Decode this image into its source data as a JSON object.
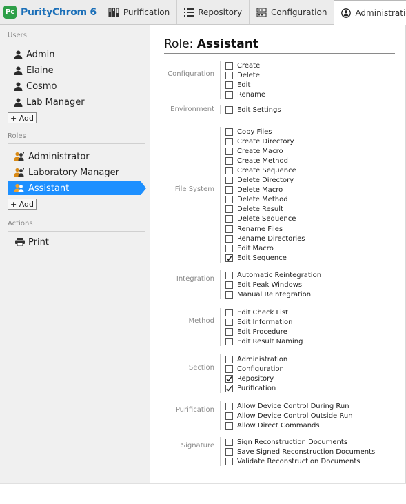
{
  "app": {
    "name": "PurityChrom 6",
    "logo_text": "Pc",
    "brand_color": "#2e9f48",
    "title_color": "#1b6fb8"
  },
  "tabs": [
    {
      "label": "Purification",
      "icon": "vials-icon"
    },
    {
      "label": "Repository",
      "icon": "list-icon"
    },
    {
      "label": "Configuration",
      "icon": "device-icon"
    },
    {
      "label": "Administration",
      "icon": "user-circle-icon",
      "active": true
    }
  ],
  "sidebar": {
    "users_title": "Users",
    "users": [
      "Admin",
      "Elaine",
      "Cosmo",
      "Lab Manager"
    ],
    "add_label": "+ Add",
    "roles_title": "Roles",
    "roles": [
      "Administrator",
      "Laboratory Manager",
      "Assistant"
    ],
    "selected_role": "Assistant",
    "selection_color": "#1e90ff",
    "actions_title": "Actions",
    "actions": [
      "Print"
    ]
  },
  "main": {
    "title_prefix": "Role:",
    "title_role": "Assistant",
    "groups": [
      {
        "label": "Configuration",
        "permissions": [
          {
            "label": "Create",
            "checked": false
          },
          {
            "label": "Delete",
            "checked": false
          },
          {
            "label": "Edit",
            "checked": false
          },
          {
            "label": "Rename",
            "checked": false
          }
        ]
      },
      {
        "label": "Environment",
        "permissions": [
          {
            "label": "Edit Settings",
            "checked": false
          }
        ]
      },
      {
        "label": "File System",
        "permissions": [
          {
            "label": "Copy Files",
            "checked": false
          },
          {
            "label": "Create Directory",
            "checked": false
          },
          {
            "label": "Create Macro",
            "checked": false
          },
          {
            "label": "Create Method",
            "checked": false
          },
          {
            "label": "Create Sequence",
            "checked": false
          },
          {
            "label": "Delete Directory",
            "checked": false
          },
          {
            "label": "Delete Macro",
            "checked": false
          },
          {
            "label": "Delete Method",
            "checked": false
          },
          {
            "label": "Delete Result",
            "checked": false
          },
          {
            "label": "Delete Sequence",
            "checked": false
          },
          {
            "label": "Rename Files",
            "checked": false
          },
          {
            "label": "Rename Directories",
            "checked": false
          },
          {
            "label": "Edit Macro",
            "checked": false
          },
          {
            "label": "Edit Sequence",
            "checked": true
          }
        ]
      },
      {
        "label": "Integration",
        "permissions": [
          {
            "label": "Automatic Reintegration",
            "checked": false
          },
          {
            "label": "Edit Peak Windows",
            "checked": false
          },
          {
            "label": "Manual Reintegration",
            "checked": false
          }
        ]
      },
      {
        "label": "Method",
        "permissions": [
          {
            "label": "Edit Check List",
            "checked": false
          },
          {
            "label": "Edit Information",
            "checked": false
          },
          {
            "label": "Edit Procedure",
            "checked": false
          },
          {
            "label": "Edit Result Naming",
            "checked": false
          }
        ]
      },
      {
        "label": "Section",
        "permissions": [
          {
            "label": "Administration",
            "checked": false
          },
          {
            "label": "Configuration",
            "checked": false
          },
          {
            "label": "Repository",
            "checked": true
          },
          {
            "label": "Purification",
            "checked": true
          }
        ]
      },
      {
        "label": "Purification",
        "permissions": [
          {
            "label": "Allow Device Control During Run",
            "checked": false
          },
          {
            "label": "Allow Device Control Outside Run",
            "checked": false
          },
          {
            "label": "Allow Direct Commands",
            "checked": false
          }
        ]
      },
      {
        "label": "Signature",
        "permissions": [
          {
            "label": "Sign Reconstruction Documents",
            "checked": false
          },
          {
            "label": "Save Signed Reconstruction Documents",
            "checked": false
          },
          {
            "label": "Validate Reconstruction Documents",
            "checked": false
          }
        ]
      }
    ]
  }
}
